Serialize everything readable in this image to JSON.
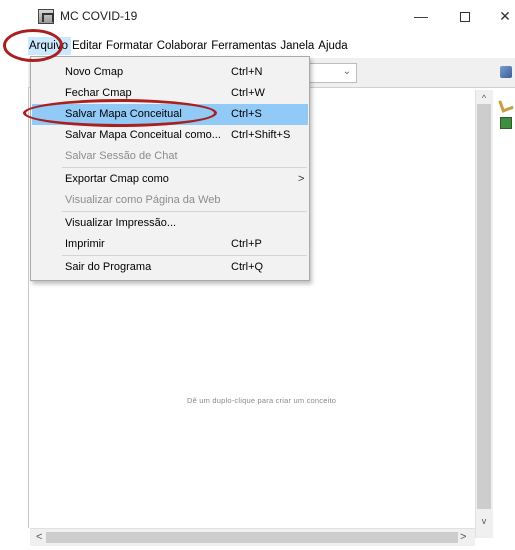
{
  "window": {
    "title": "MC COVID-19",
    "icon": "cmap-app-icon",
    "controls": {
      "minimize": "—",
      "close": "✕"
    }
  },
  "menubar": [
    {
      "label": "Arquivo",
      "active": true
    },
    {
      "label": "Editar"
    },
    {
      "label": "Formatar"
    },
    {
      "label": "Colaborar"
    },
    {
      "label": "Ferramentas"
    },
    {
      "label": "Janela"
    },
    {
      "label": "Ajuda"
    }
  ],
  "file_menu": {
    "items": [
      {
        "label": "Novo Cmap",
        "shortcut": "Ctrl+N",
        "enabled": true
      },
      {
        "label": "Fechar Cmap",
        "shortcut": "Ctrl+W",
        "enabled": true
      },
      {
        "label": "Salvar Mapa Conceitual",
        "shortcut": "Ctrl+S",
        "enabled": true,
        "highlighted": true
      },
      {
        "label": "Salvar Mapa Conceitual como...",
        "shortcut": "Ctrl+Shift+S",
        "enabled": true
      },
      {
        "label": "Salvar Sessão de Chat",
        "shortcut": "",
        "enabled": false
      },
      {
        "label": "Exportar Cmap como",
        "shortcut": "",
        "enabled": true,
        "submenu": true,
        "arrow": ">"
      },
      {
        "label": "Visualizar como Página da Web",
        "shortcut": "",
        "enabled": false
      },
      {
        "label": "Visualizar Impressão...",
        "shortcut": "",
        "enabled": true
      },
      {
        "label": "Imprimir",
        "shortcut": "Ctrl+P",
        "enabled": true
      },
      {
        "label": "Sair do Programa",
        "shortcut": "Ctrl+Q",
        "enabled": true
      }
    ]
  },
  "canvas": {
    "hint": "Dê um duplo-clique para criar um conceito"
  },
  "scrollbars": {
    "up": "^",
    "down": "v",
    "left": "<",
    "right": ">"
  },
  "colors": {
    "highlight": "#91c9f7",
    "annotation": "#a8201f",
    "menu_bg": "#f2f2f2"
  }
}
